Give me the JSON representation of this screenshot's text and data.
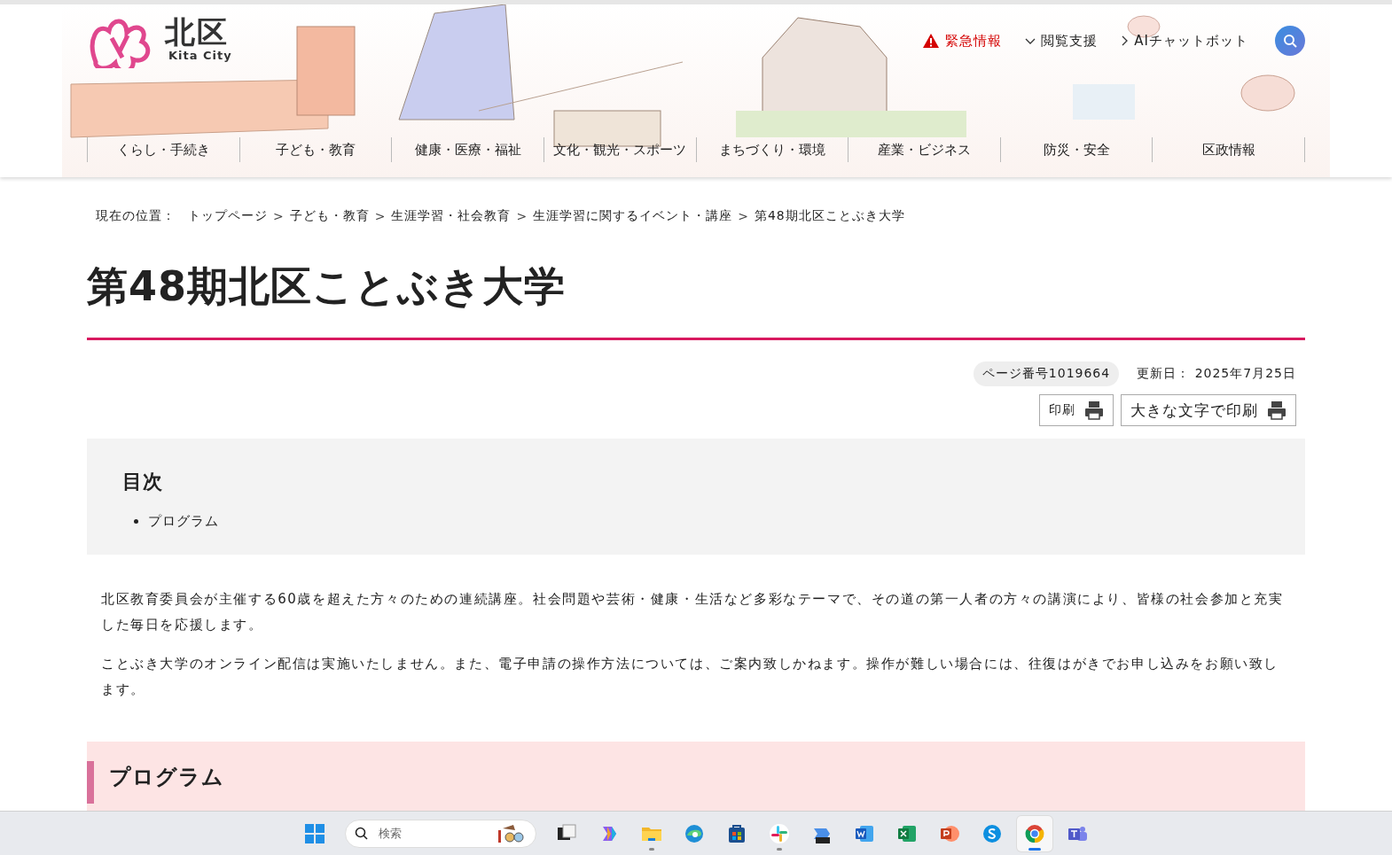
{
  "header": {
    "logo": {
      "name": "北区",
      "subtitle": "Kita City"
    },
    "utility_links": [
      {
        "kind": "alert",
        "label": "緊急情報"
      },
      {
        "kind": "dropdown",
        "label": "閲覧支援"
      },
      {
        "kind": "link",
        "label": "AIチャットボット"
      }
    ],
    "nav_items": [
      "くらし・手続き",
      "子ども・教育",
      "健康・医療・福祉",
      "文化・観光・スポーツ",
      "まちづくり・環境",
      "産業・ビジネス",
      "防災・安全",
      "区政情報"
    ]
  },
  "breadcrumb": {
    "label": "現在の位置：",
    "separator": ">",
    "items": [
      "トップページ",
      "子ども・教育",
      "生涯学習・社会教育",
      "生涯学習に関するイベント・講座",
      "第48期北区ことぶき大学"
    ]
  },
  "title": "第48期北区ことぶき大学",
  "meta": {
    "page_number": "ページ番号1019664",
    "updated": "更新日： 2025年7月25日"
  },
  "print_buttons": [
    "印刷",
    "大きな文字で印刷"
  ],
  "toc": {
    "heading": "目次",
    "items": [
      "プログラム"
    ]
  },
  "paragraphs": [
    "北区教育委員会が主催する60歳を超えた方々のための連続講座。社会問題や芸術・健康・生活など多彩なテーマで、その道の第一人者の方々の講演により、皆様の社会参加と充実した毎日を応援します。",
    "ことぶき大学のオンライン配信は実施いたしません。また、電子申請の操作方法については、ご案内致しかねます。操作が難しい場合には、往復はがきでお申し込みをお願い致します。"
  ],
  "section_heading": "プログラム",
  "taskbar": {
    "search_placeholder": "検索",
    "apps": [
      {
        "kind": "task-view",
        "running": false,
        "selected": false
      },
      {
        "kind": "copilot",
        "running": false,
        "selected": false
      },
      {
        "kind": "folder",
        "running": true,
        "selected": false
      },
      {
        "kind": "edge",
        "running": false,
        "selected": false
      },
      {
        "kind": "store",
        "running": false,
        "selected": false
      },
      {
        "kind": "slack",
        "running": true,
        "selected": false
      },
      {
        "kind": "m365",
        "running": false,
        "selected": false
      },
      {
        "kind": "word",
        "running": false,
        "selected": false
      },
      {
        "kind": "excel",
        "running": false,
        "selected": false
      },
      {
        "kind": "powerpoint",
        "running": false,
        "selected": false
      },
      {
        "kind": "skype",
        "running": false,
        "selected": false
      },
      {
        "kind": "chrome",
        "running": true,
        "selected": true
      },
      {
        "kind": "teams",
        "running": false,
        "selected": false
      }
    ]
  }
}
